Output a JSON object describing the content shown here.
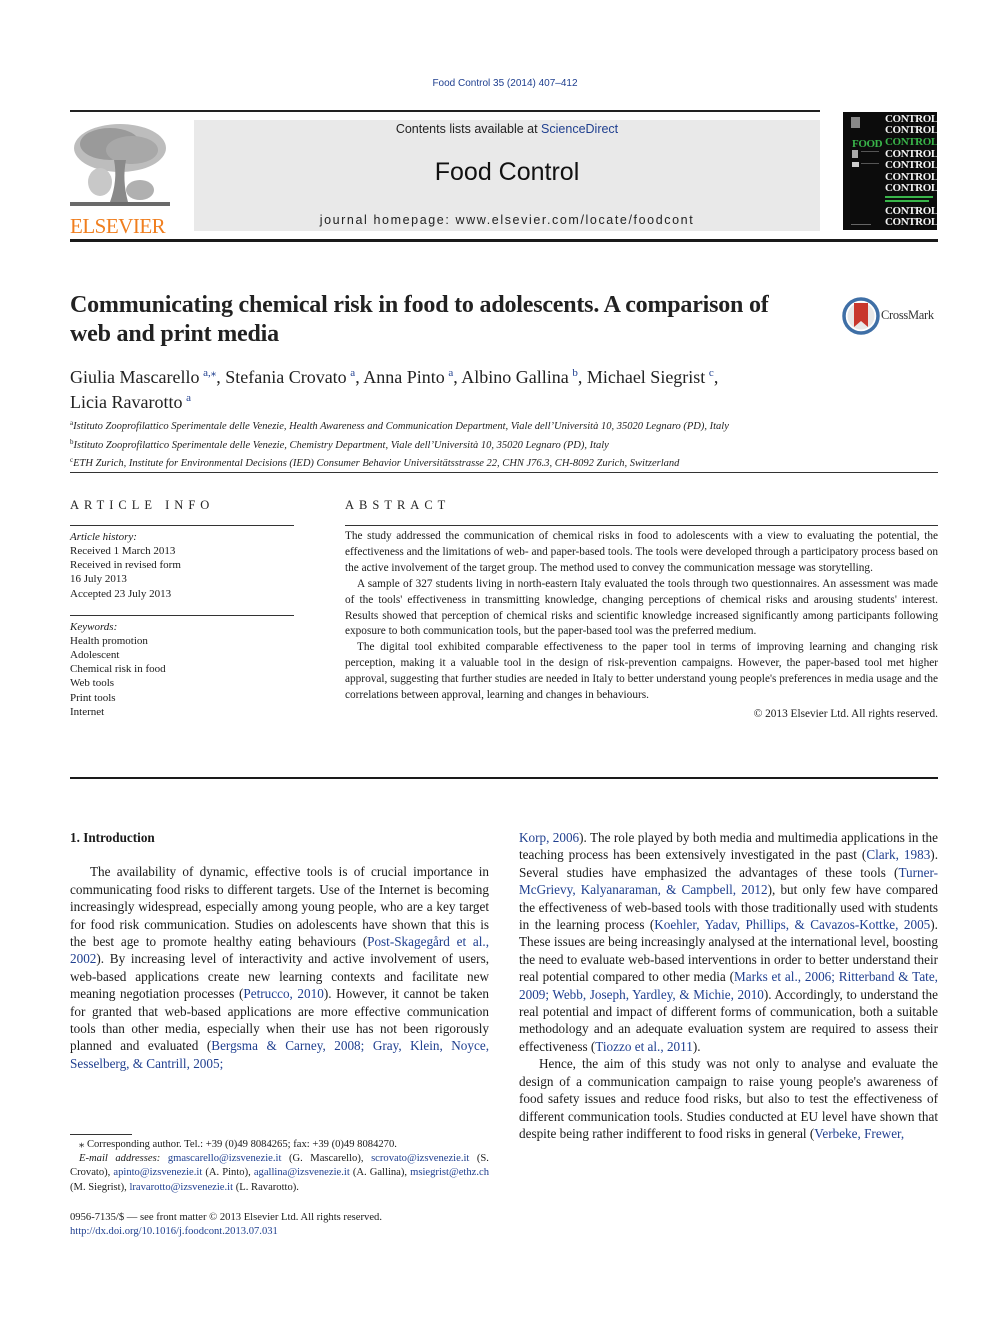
{
  "journal_ref": "Food Control 35 (2014) 407–412",
  "masthead": {
    "contents_prefix": "Contents lists available at ",
    "contents_link": "ScienceDirect",
    "journal_title": "Food Control",
    "homepage": "journal homepage: www.elsevier.com/locate/foodcont"
  },
  "publisher": {
    "logo_text": "ELSEVIER",
    "logo_color": "#f07e1e"
  },
  "cover": {
    "words": [
      "CONTROL",
      "CONTROL",
      "CONTROL",
      "CONTROL",
      "CONTROL",
      "CONTROL",
      "CONTROL",
      "CONTROL",
      "CONTROL"
    ],
    "food_word": "FOOD"
  },
  "crossmark": {
    "label": "CrossMark"
  },
  "article": {
    "title": "Communicating chemical risk in food to adolescents. A comparison of web and print media",
    "authors": [
      {
        "name": "Giulia Mascarello",
        "aff": "a,⁎"
      },
      {
        "name": "Stefania Crovato",
        "aff": "a"
      },
      {
        "name": "Anna Pinto",
        "aff": "a"
      },
      {
        "name": "Albino Gallina",
        "aff": "b"
      },
      {
        "name": "Michael Siegrist",
        "aff": "c"
      },
      {
        "name": "Licia Ravarotto",
        "aff": "a"
      }
    ],
    "affiliations": [
      {
        "key": "a",
        "text": "Istituto Zooprofilattico Sperimentale delle Venezie, Health Awareness and Communication Department, Viale dell’Università 10, 35020 Legnaro (PD), Italy"
      },
      {
        "key": "b",
        "text": "Istituto Zooprofilattico Sperimentale delle Venezie, Chemistry Department, Viale dell’Università 10, 35020 Legnaro (PD), Italy"
      },
      {
        "key": "c",
        "text": "ETH Zurich, Institute for Environmental Decisions (IED) Consumer Behavior Universitätsstrasse 22, CHN J76.3, CH-8092 Zurich, Switzerland"
      }
    ]
  },
  "article_info": {
    "heading": "ARTICLE INFO",
    "history_label": "Article history:",
    "history": [
      "Received 1 March 2013",
      "Received in revised form",
      "16 July 2013",
      "Accepted 23 July 2013"
    ],
    "keywords_label": "Keywords:",
    "keywords": [
      "Health promotion",
      "Adolescent",
      "Chemical risk in food",
      "Web tools",
      "Print tools",
      "Internet"
    ]
  },
  "abstract": {
    "heading": "ABSTRACT",
    "paragraphs": [
      "The study addressed the communication of chemical risks in food to adolescents with a view to evaluating the potential, the effectiveness and the limitations of web- and paper-based tools. The tools were developed through a participatory process based on the active involvement of the target group. The method used to convey the communication message was storytelling.",
      "A sample of 327 students living in north-eastern Italy evaluated the tools through two questionnaires. An assessment was made of the tools' effectiveness in transmitting knowledge, changing perceptions of chemical risks and arousing students' interest. Results showed that perception of chemical risks and scientific knowledge increased significantly among participants following exposure to both communication tools, but the paper-based tool was the preferred medium.",
      "The digital tool exhibited comparable effectiveness to the paper tool in terms of improving learning and changing risk perception, making it a valuable tool in the design of risk-prevention campaigns. However, the paper-based tool met higher approval, suggesting that further studies are needed in Italy to better understand young people's preferences in media usage and the correlations between approval, learning and changes in behaviours."
    ],
    "copyright": "© 2013 Elsevier Ltd. All rights reserved."
  },
  "intro": {
    "heading": "1.  Introduction",
    "left": {
      "t1": "The availability of dynamic, effective tools is of crucial importance in communicating food risks to different targets. Use of the Internet is becoming increasingly widespread, especially among young people, who are a key target for food risk communication. Studies on adolescents have shown that this is the best age to promote healthy eating behaviours (",
      "c1": "Post-Skagegård et al., 2002",
      "t2": "). By increasing level of interactivity and active involvement of users, web-based applications create new learning contexts and facilitate new meaning negotiation processes (",
      "c2": "Petrucco, 2010",
      "t3": "). However, it cannot be taken for granted that web-based applications are more effective communication tools than other media, especially when their use has not been rigorously planned and evaluated (",
      "c3": "Bergsma & Carney, 2008; Gray, Klein, Noyce, Sesselberg, & Cantrill, 2005;"
    },
    "right": {
      "c0": "Korp, 2006",
      "t1": "). The role played by both media and multimedia applications in the teaching process has been extensively investigated in the past (",
      "c1": "Clark, 1983",
      "t2": "). Several studies have emphasized the advantages of these tools (",
      "c2": "Turner-McGrievy, Kalyanaraman, & Campbell, 2012",
      "t3": "), but only few have compared the effectiveness of web-based tools with those traditionally used with students in the learning process (",
      "c3": "Koehler, Yadav, Phillips, & Cavazos-Kottke, 2005",
      "t4": "). These issues are being increasingly analysed at the international level, boosting the need to evaluate web-based interventions in order to better understand their real potential compared to other media (",
      "c4": "Marks et al., 2006; Ritterband & Tate, 2009; Webb, Joseph, Yardley, & Michie, 2010",
      "t5": "). Accordingly, to understand the real potential and impact of different forms of communication, both a suitable methodology and an adequate evaluation system are required to assess their effectiveness (",
      "c5": "Tiozzo et al., 2011",
      "t6": ").",
      "p2_text": "Hence, the aim of this study was not only to analyse and evaluate the design of a communication campaign to raise young people's awareness of food safety issues and reduce food risks, but also to test the effectiveness of different communication tools. Studies conducted at EU level have shown that despite being rather indifferent to food risks in general (",
      "p2_cite": "Verbeke, Frewer,"
    }
  },
  "footnotes": {
    "corresponding": "⁎ Corresponding author. Tel.: +39 (0)49 8084265; fax: +39 (0)49 8084270.",
    "email_label": "E-mail addresses:",
    "emails": [
      {
        "email": "gmascarello@izsvenezie.it",
        "name": "(G. Mascarello),"
      },
      {
        "email": "scrovato@izsvenezie.it",
        "name": "(S. Crovato),"
      },
      {
        "email": "apinto@izsvenezie.it",
        "name": "(A. Pinto),"
      },
      {
        "email": "agallina@izsvenezie.it",
        "name": "(A. Gallina),"
      },
      {
        "email": "msiegrist@ethz.ch",
        "name": "(M. Siegrist),"
      },
      {
        "email": "lravarotto@izsvenezie.it",
        "name": "(L. Ravarotto)."
      }
    ],
    "issn": "0956-7135/$ — see front matter © 2013 Elsevier Ltd. All rights reserved.",
    "doi": "http://dx.doi.org/10.1016/j.foodcont.2013.07.031"
  },
  "colors": {
    "link": "#1f3f8f",
    "elsevier_orange": "#f07e1e",
    "masthead_bg": "#e9e9e9",
    "cover_green": "#39b54a"
  }
}
